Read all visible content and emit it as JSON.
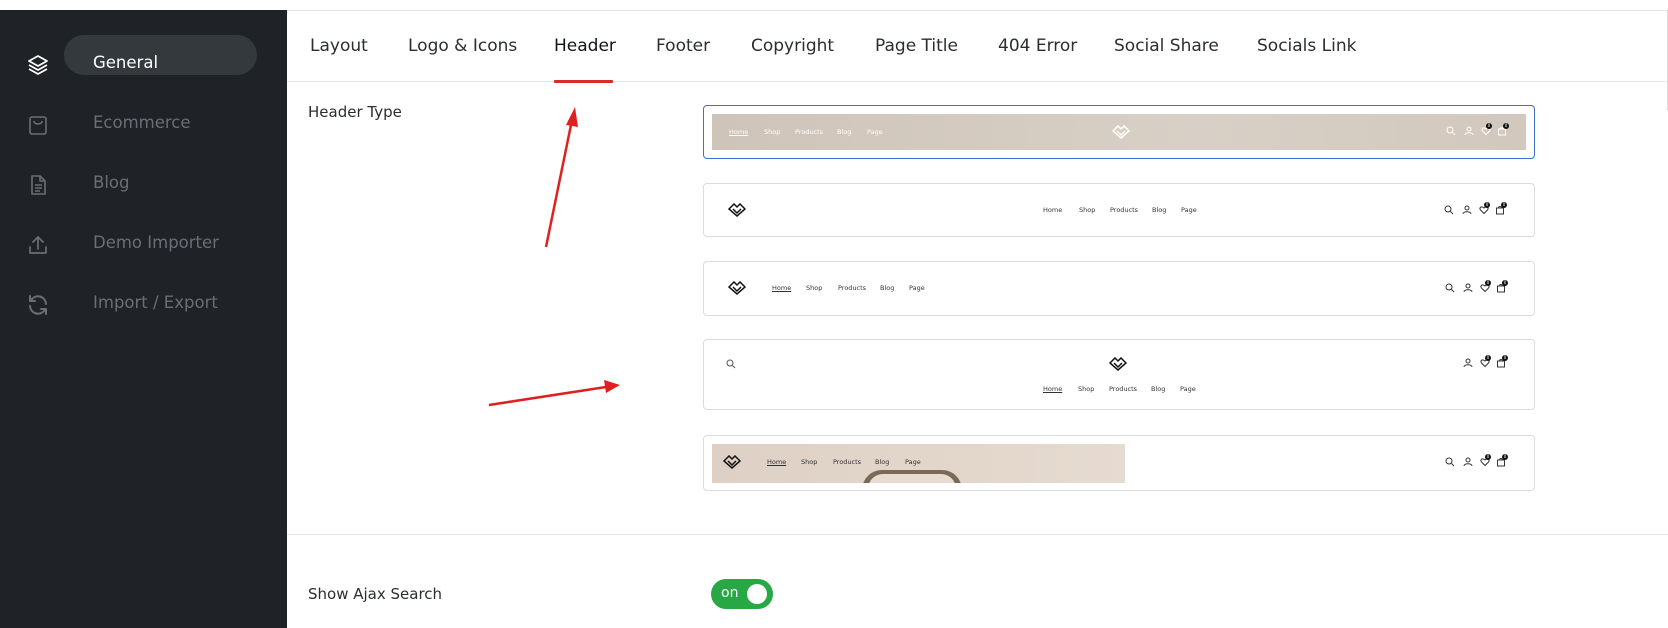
{
  "sidebar": {
    "items": [
      {
        "label": "General",
        "icon": "layers-icon",
        "active": true
      },
      {
        "label": "Ecommerce",
        "icon": "shopping-bag-icon",
        "active": false
      },
      {
        "label": "Blog",
        "icon": "document-icon",
        "active": false
      },
      {
        "label": "Demo Importer",
        "icon": "upload-icon",
        "active": false
      },
      {
        "label": "Import / Export",
        "icon": "refresh-icon",
        "active": false
      }
    ]
  },
  "tabs": [
    {
      "label": "Layout"
    },
    {
      "label": "Logo & Icons"
    },
    {
      "label": "Header",
      "active": true
    },
    {
      "label": "Footer"
    },
    {
      "label": "Copyright"
    },
    {
      "label": "Page Title"
    },
    {
      "label": "404 Error"
    },
    {
      "label": "Social Share"
    },
    {
      "label": "Socials Link"
    }
  ],
  "header_type": {
    "label": "Header Type",
    "nav": {
      "home": "Home",
      "shop": "Shop",
      "products": "Products",
      "blog": "Blog",
      "page": "Page"
    },
    "badge": "0",
    "selected_index": 0
  },
  "ajax_search": {
    "label": "Show Ajax Search",
    "toggle": "on"
  },
  "colors": {
    "sidebar_bg": "#1f2327",
    "active_pill": "#34393e",
    "tab_underline": "#d92b2b",
    "selected_border": "#3b6fd1",
    "toggle_on": "#28a745",
    "arrow": "#e02020"
  }
}
